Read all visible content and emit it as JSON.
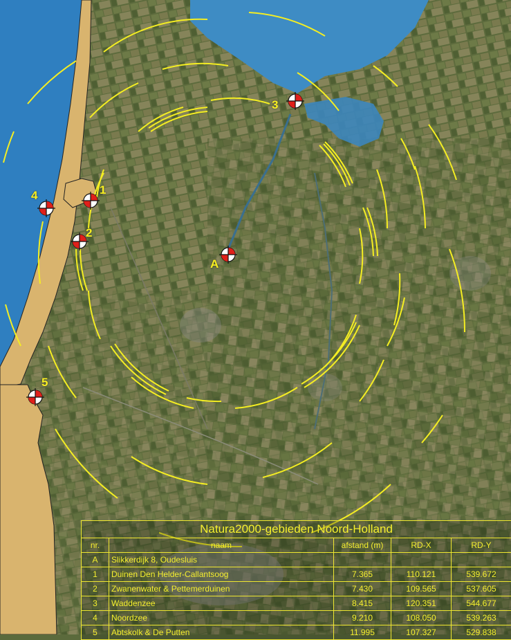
{
  "table": {
    "title": "Natura2000-gebieden Noord-Holland",
    "headers": [
      "nr.",
      "naam",
      "afstand (m)",
      "RD-X",
      "RD-Y"
    ],
    "rows": [
      {
        "nr": "A",
        "naam": "Slikkerdijk 8, Oudesluis",
        "afstand": "",
        "rdx": "",
        "rdy": ""
      },
      {
        "nr": "1",
        "naam": "Duinen Den Helder-Callantsoog",
        "afstand": "7.365",
        "rdx": "110.121",
        "rdy": "539.672"
      },
      {
        "nr": "2",
        "naam": "Zwanenwater & Pettemerduinen",
        "afstand": "7.430",
        "rdx": "109.565",
        "rdy": "537.605"
      },
      {
        "nr": "3",
        "naam": "Waddenzee",
        "afstand": "8.415",
        "rdx": "120.351",
        "rdy": "544.677"
      },
      {
        "nr": "4",
        "naam": "Noordzee",
        "afstand": "9.210",
        "rdx": "108.050",
        "rdy": "539.263"
      },
      {
        "nr": "5",
        "naam": "Abtskolk & De Putten",
        "afstand": "11.995",
        "rdx": "107.327",
        "rdy": "529.838"
      }
    ]
  },
  "markers": [
    {
      "id": "A",
      "label": "A"
    },
    {
      "id": "1",
      "label": "1"
    },
    {
      "id": "2",
      "label": "2"
    },
    {
      "id": "3",
      "label": "3"
    },
    {
      "id": "4",
      "label": "4"
    },
    {
      "id": "5",
      "label": "5"
    }
  ],
  "colors": {
    "sea": "#2f7fc0",
    "natura_area": "#d9b46e",
    "ring": "#f5ee22",
    "marker_red": "#e0201a",
    "label": "#f8f020"
  }
}
